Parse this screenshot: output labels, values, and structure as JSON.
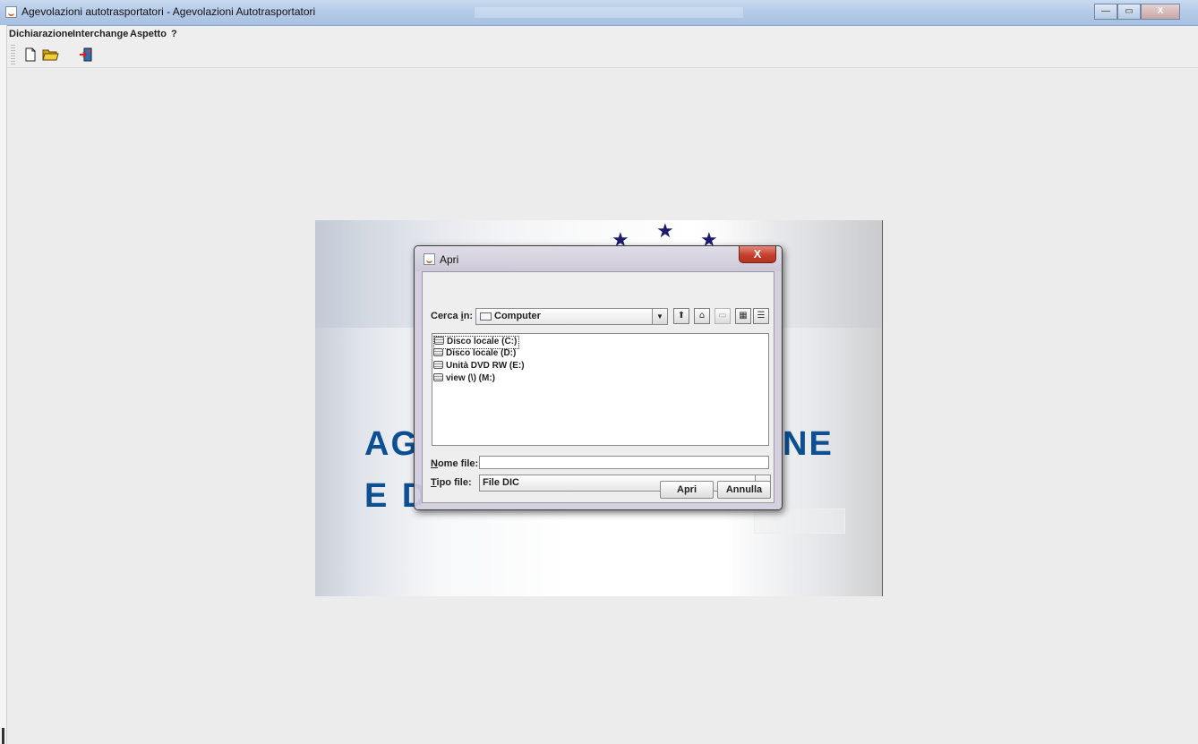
{
  "window": {
    "title": "Agevolazioni autotrasportatori - Agevolazioni Autotrasportatori",
    "controls": {
      "minimize": "—",
      "maximize": "▭",
      "close": "X"
    }
  },
  "menubar": {
    "items": [
      "Dichiarazione",
      "Interchange",
      "Aspetto",
      "?"
    ]
  },
  "toolbar": {
    "buttons": [
      {
        "icon": "new-document-icon"
      },
      {
        "icon": "open-folder-icon"
      },
      {
        "icon": "exit-door-icon"
      }
    ]
  },
  "splash": {
    "line1_left": "AG",
    "line1_right": "NE",
    "line2_left": "E D",
    "colors": {
      "text": "#0c4f93",
      "stars": "#1e1a6e"
    }
  },
  "dialog": {
    "title": "Apri",
    "close": "X",
    "look_in": {
      "label_prefix": "Cerca ",
      "label_mnemonic": "i",
      "label_suffix": "n:",
      "value": "Computer"
    },
    "files": [
      "Disco locale (C:)",
      "Disco locale (D:)",
      "Unità DVD RW (E:)",
      "view (\\) (M:)"
    ],
    "filename": {
      "label_mnemonic": "N",
      "label_rest": "ome file:",
      "value": ""
    },
    "filetype": {
      "label_mnemonic": "T",
      "label_rest": "ipo file:",
      "value": "File DIC"
    },
    "buttons": {
      "open": "Apri",
      "cancel": "Annulla"
    }
  }
}
